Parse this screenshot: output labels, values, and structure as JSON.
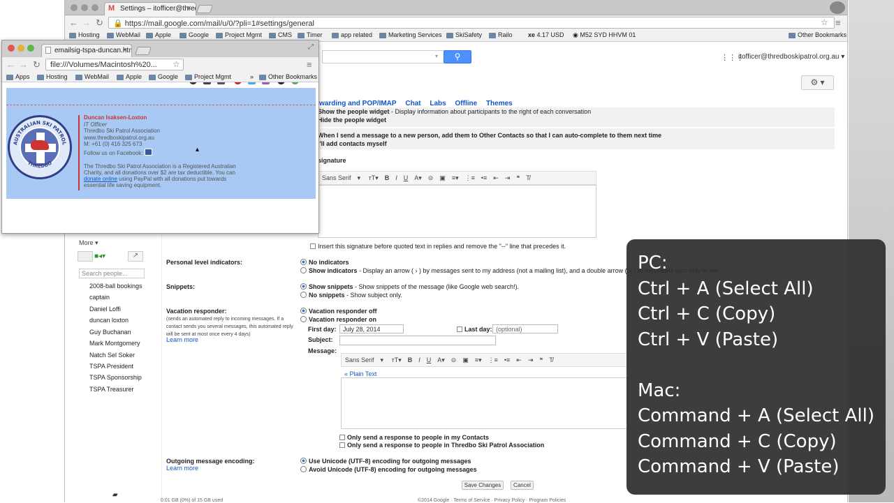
{
  "main_browser": {
    "tab_title": "Settings – itofficer@thredb",
    "url": "https://mail.google.com/mail/u/0/?pli=1#settings/general",
    "bookmarks": [
      "Hosting",
      "WebMail",
      "Apple",
      "Google",
      "Project Mgmt",
      "CMS",
      "Timer",
      "app related",
      "Marketing Services",
      "SkiSafety",
      "Railo",
      "4.17 USD",
      "M52 SYD HHVM 01",
      "Other Bookmarks"
    ],
    "account": "itofficer@thredboskipatrol.org.au",
    "settings_tabs": [
      "warding and POP/IMAP",
      "Chat",
      "Labs",
      "Offline",
      "Themes"
    ],
    "people_widget": {
      "show": "Show the people widget",
      "show_desc": " - Display information about participants to the right of each conversation",
      "hide": "Hide the people widget"
    },
    "create_contacts": {
      "auto": "When I send a message to a new person, add them to Other Contacts so that I can auto-complete to them next time",
      "manual": "I'll add contacts myself"
    },
    "signature": {
      "label": "signature",
      "font": "Sans Serif",
      "insert_before": "Insert this signature before quoted text in replies and remove the \"--\" line that precedes it."
    },
    "personal_level": {
      "label": "Personal level indicators:",
      "none": "No indicators",
      "show": "Show indicators",
      "show_desc": " - Display an arrow ( › ) by messages sent to my address (not a mailing list), and a double arrow ( » ) to messages sent only to me."
    },
    "snippets": {
      "label": "Snippets:",
      "show": "Show snippets",
      "show_desc": " - Show snippets of the message (like Google web search!).",
      "none": "No snippets",
      "none_desc": " - Show subject only."
    },
    "vacation": {
      "label": "Vacation responder:",
      "note": "(sends an automated reply to incoming messages. If a contact sends you several messages, this automated reply will be sent at most once every 4 days)",
      "learn_more": "Learn more",
      "off": "Vacation responder off",
      "on": "Vacation responder on",
      "first_day_label": "First day:",
      "first_day": "July 28, 2014",
      "last_day_label": "Last day:",
      "last_day_placeholder": "(optional)",
      "subject_label": "Subject:",
      "message_label": "Message:",
      "font": "Sans Serif",
      "plain_text": "« Plain Text",
      "only_contacts": "Only send a response to people in my Contacts",
      "only_org": "Only send a response to people in Thredbo Ski Patrol Association"
    },
    "encoding": {
      "label": "Outgoing message encoding:",
      "learn_more": "Learn more",
      "use": "Use Unicode (UTF-8) encoding for outgoing messages",
      "avoid": "Avoid Unicode (UTF-8) encoding for outgoing messages"
    },
    "buttons": {
      "save": "Save Changes",
      "cancel": "Cancel"
    },
    "footer": {
      "usage": "0.01 GB (0%) of 15 GB used",
      "links": "©2014 Google · Terms of Service · Privacy Policy · Program Policies"
    },
    "left_nav": {
      "more": "More ▾",
      "search_placeholder": "Search people...",
      "contacts": [
        "2008-ball bookings",
        "captain",
        "Daniel Loffi",
        "duncan loxton",
        "Guy Buchanan",
        "Mark Montgomery",
        "Natch Sel Soker",
        "TSPA President",
        "TSPA Sponsorship",
        "TSPA Treasurer"
      ]
    }
  },
  "popup_browser": {
    "tab_title": "emailsig-tspa-duncan.htm",
    "url": "file:///Volumes/Macintosh%20...",
    "bookmarks": [
      "Apps",
      "Hosting",
      "WebMail",
      "Apple",
      "Google",
      "Project Mgmt",
      "»",
      "Other Bookmarks"
    ],
    "signature": {
      "name": "Duncan Isaksen-Loxton",
      "role": "IT Officer",
      "org": "Thredbo Ski Patrol Association",
      "website": "www.thredboskipatrol.org.au",
      "mobile": "M: +61 (0) 416 325 673",
      "facebook": "Follow us on Facebook:",
      "charity_1": "The Thredbo Ski Patrol Association is a Registered Australian",
      "charity_2": "Charity, and all donations over $2 are tax deductible. You can",
      "donate_link": "donate online",
      "charity_3": " using PayPal with all donations put towards",
      "charity_4": "essential life saving equipment.",
      "logo_text_top": "AUSTRALIAN SKI PATROL",
      "logo_text_bottom": "THREDBO"
    }
  },
  "overlay": {
    "lines": [
      "PC:",
      "Ctrl + A (Select All)",
      "Ctrl + C (Copy)",
      "Ctrl + V (Paste)",
      "",
      "Mac:",
      "Command + A (Select All)",
      "Command + C (Copy)",
      "Command + V (Paste)"
    ]
  }
}
